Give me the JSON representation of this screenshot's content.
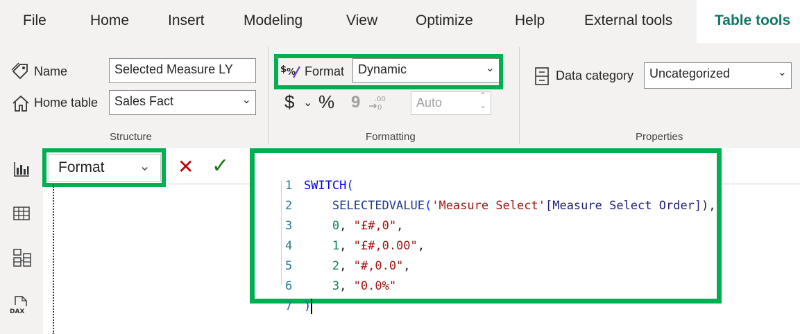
{
  "menu": {
    "tabs": [
      "File",
      "Home",
      "Insert",
      "Modeling",
      "View",
      "Optimize",
      "Help",
      "External tools",
      "Table tools"
    ],
    "active_tab": "Table tools"
  },
  "structure": {
    "name_label": "Name",
    "name_value": "Selected Measure LY",
    "home_table_label": "Home table",
    "home_table_value": "Sales Fact",
    "group_label": "Structure"
  },
  "formatting": {
    "format_label": "Format",
    "format_value": "Dynamic",
    "currency_symbol": "$",
    "percent_symbol": "%",
    "comma_symbol": "9",
    "decimals_value": "Auto",
    "group_label": "Formatting"
  },
  "properties": {
    "data_category_label": "Data category",
    "data_category_value": "Uncategorized",
    "group_label": "Properties"
  },
  "formula_bar": {
    "dropdown_value": "Format",
    "cancel_symbol": "✕",
    "commit_symbol": "✓"
  },
  "editor": {
    "line_numbers": [
      "1",
      "2",
      "3",
      "4",
      "5",
      "6",
      "7"
    ],
    "line1": {
      "keyword": "SWITCH",
      "paren": "("
    },
    "line2": {
      "fn": "SELECTEDVALUE",
      "open": "(",
      "table": "'Measure Select'",
      "column": "[Measure Select Order]",
      "close": "),"
    },
    "line3": {
      "num": "0",
      "sep": ", ",
      "str": "\"£#,0\"",
      "end": ","
    },
    "line4": {
      "num": "1",
      "sep": ", ",
      "str": "\"£#,0.00\"",
      "end": ","
    },
    "line5": {
      "num": "2",
      "sep": ", ",
      "str": "\"#,0.0\"",
      "end": ","
    },
    "line6": {
      "num": "3",
      "sep": ", ",
      "str": "\"0.0%\""
    },
    "line7": {
      "paren": ")"
    }
  },
  "colors": {
    "highlight": "#00b050",
    "accent": "#117865",
    "ribbon_bg": "#f3f2f1"
  },
  "icons": [
    "tag-icon",
    "home-icon",
    "dynamic-format-icon",
    "data-category-icon",
    "report-view-icon",
    "table-view-icon",
    "model-view-icon",
    "dax-query-icon"
  ]
}
